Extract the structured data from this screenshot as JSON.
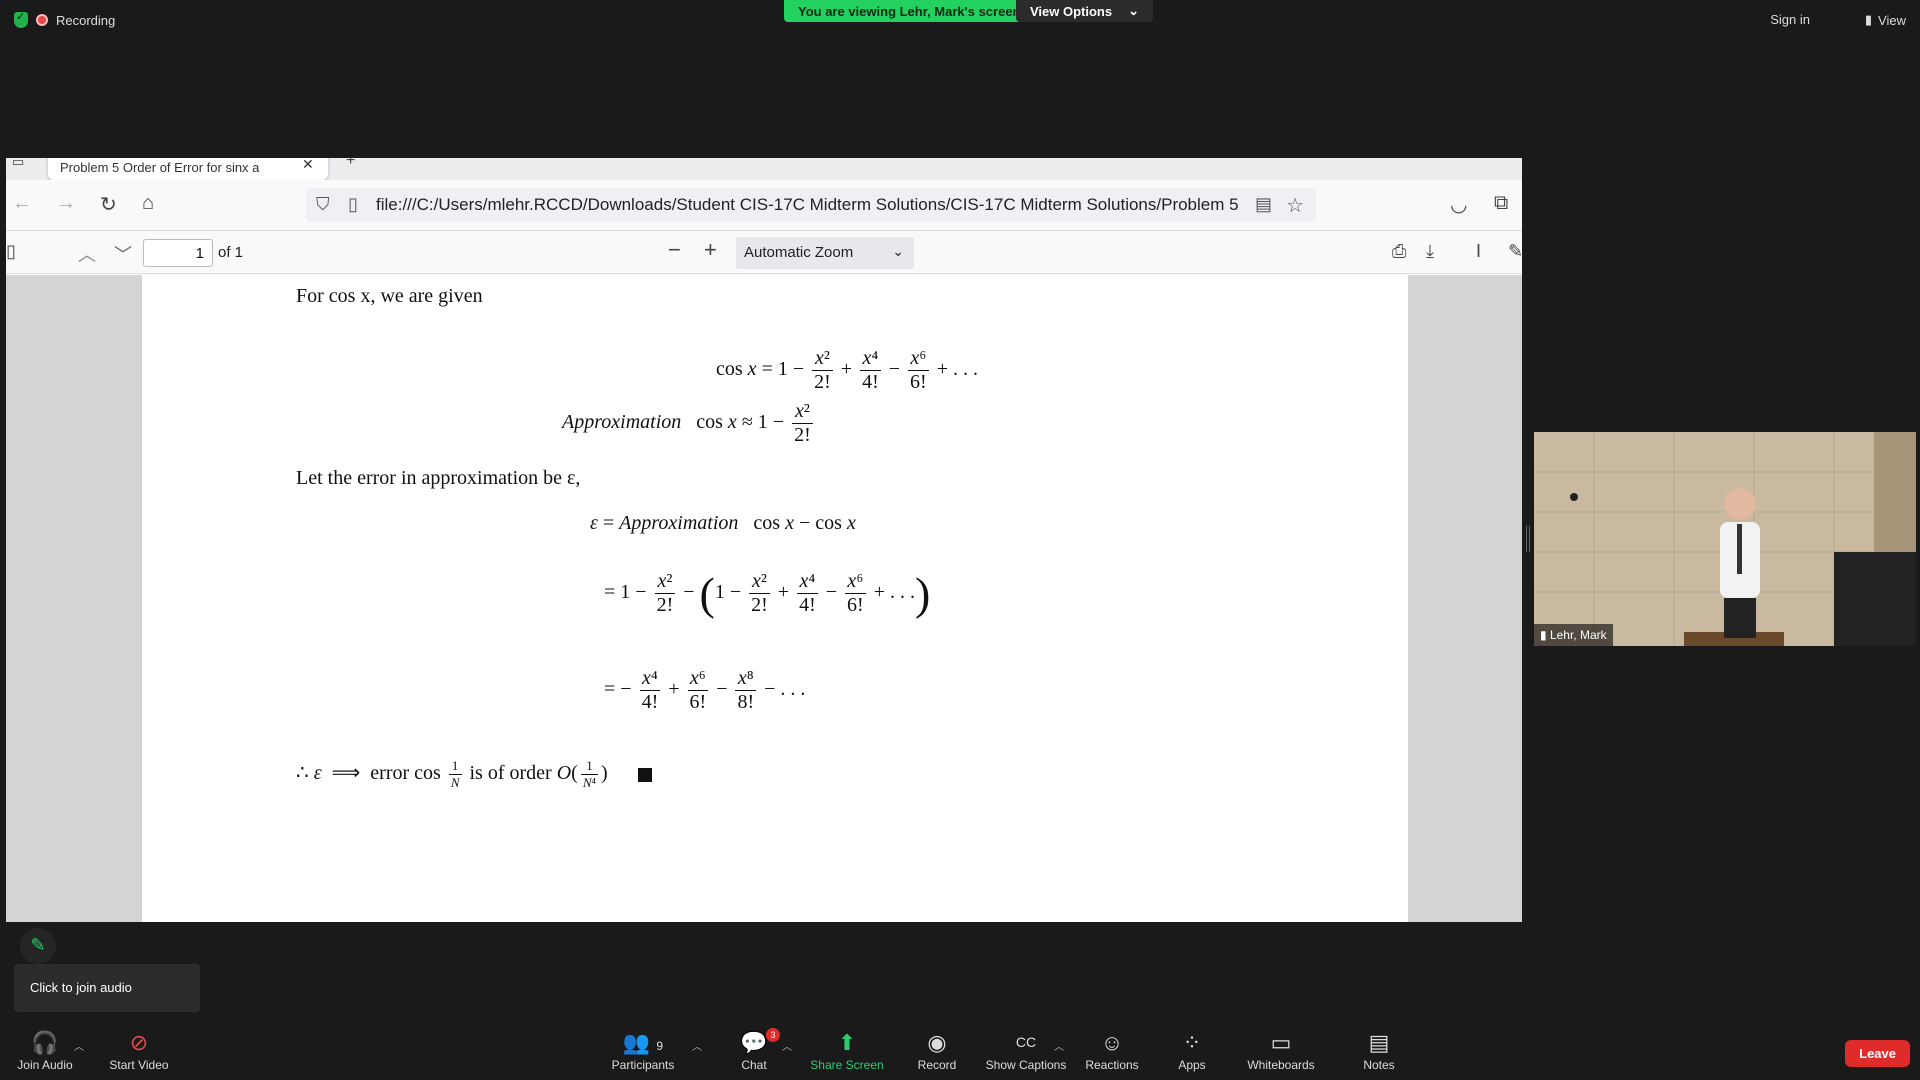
{
  "top": {
    "recording": "Recording",
    "viewing_banner": "You are viewing Lehr, Mark's screen",
    "view_options": "View Options",
    "sign_in": "Sign in",
    "view": "View"
  },
  "browser": {
    "tab_title": "Problem 5 Order of Error for sinx a",
    "url": "file:///C:/Users/mlehr.RCCD/Downloads/Student CIS-17C Midterm Solutions/CIS-17C Midterm Solutions/Problem 5",
    "pdf": {
      "page_number": "1",
      "of_pages": "of 1",
      "zoom": "Automatic Zoom"
    }
  },
  "doc": {
    "line1": "For cos x, we are given",
    "line_error": "Let the error in approximation be ε,",
    "approx_label": "Approximation",
    "conclusion_text": "error cos",
    "conclusion_order": "is of order"
  },
  "video": {
    "participant_name": "Lehr, Mark"
  },
  "tooltip": {
    "text": "Click to join audio"
  },
  "toolbar": {
    "join_audio": "Join Audio",
    "start_video": "Start Video",
    "participants": "Participants",
    "participants_count": "9",
    "chat": "Chat",
    "chat_badge": "3",
    "share_screen": "Share Screen",
    "record": "Record",
    "show_captions": "Show Captions",
    "reactions": "Reactions",
    "apps": "Apps",
    "whiteboards": "Whiteboards",
    "notes": "Notes",
    "leave": "Leave"
  },
  "colors": {
    "zoom_green": "#23d160",
    "leave_red": "#e02b2b",
    "background": "#1a1a1a"
  }
}
